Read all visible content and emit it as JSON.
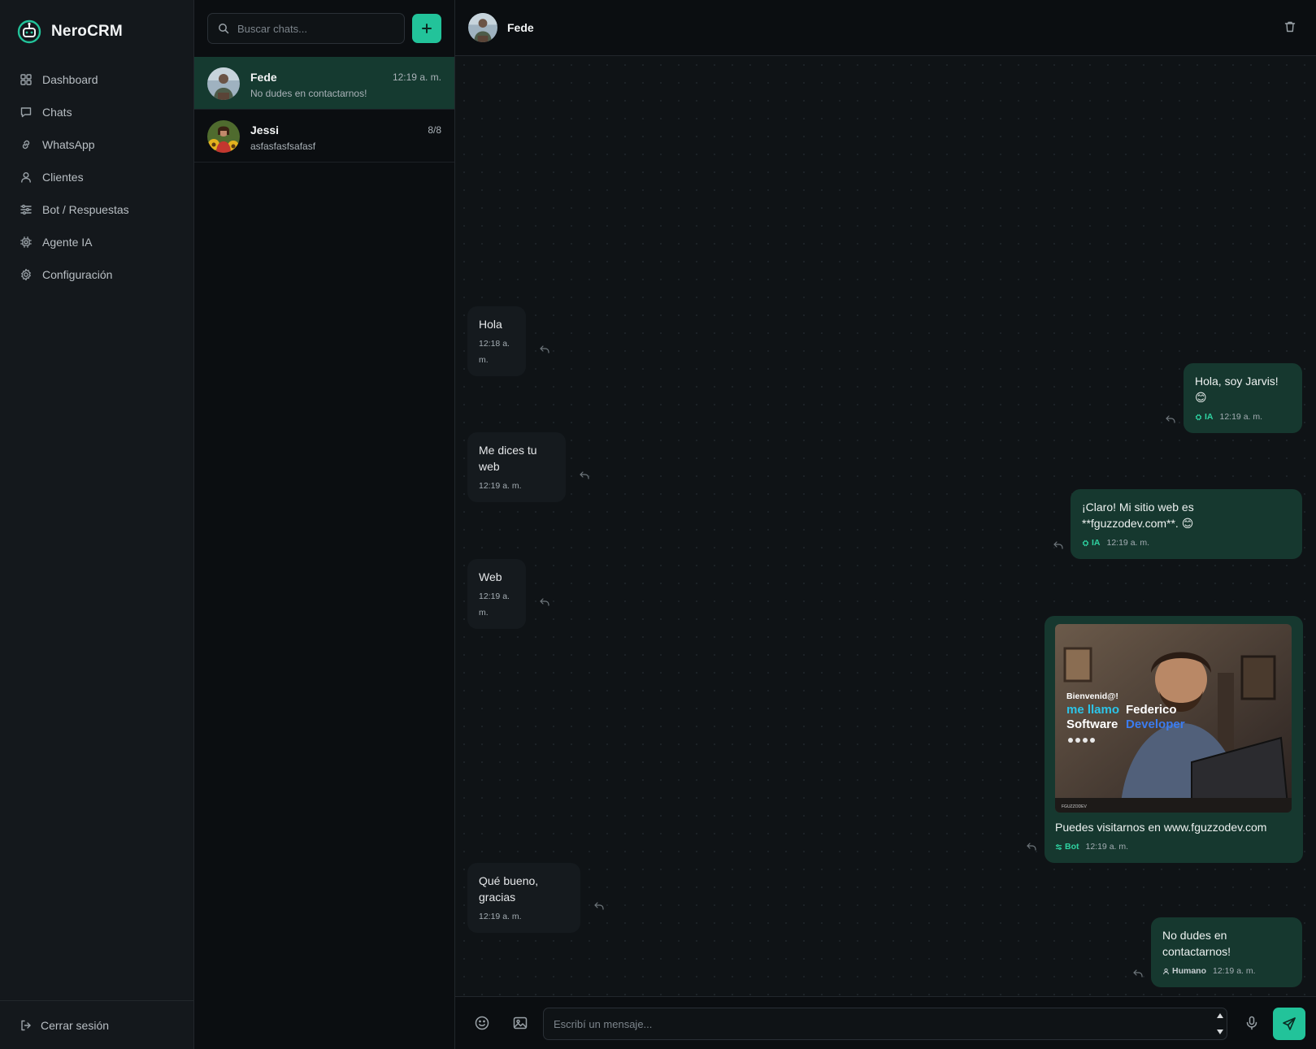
{
  "app": {
    "name": "NeroCRM"
  },
  "sidebar": {
    "items": [
      {
        "label": "Dashboard",
        "icon": "dashboard-grid-icon"
      },
      {
        "label": "Chats",
        "icon": "chat-bubble-icon"
      },
      {
        "label": "WhatsApp",
        "icon": "link-icon"
      },
      {
        "label": "Clientes",
        "icon": "user-icon"
      },
      {
        "label": "Bot / Respuestas",
        "icon": "sliders-icon"
      },
      {
        "label": "Agente IA",
        "icon": "cpu-icon"
      },
      {
        "label": "Configuración",
        "icon": "gear-icon"
      }
    ],
    "logout_label": "Cerrar sesión"
  },
  "chatlist": {
    "search_placeholder": "Buscar chats...",
    "chats": [
      {
        "name": "Fede",
        "preview": "No dudes en contactarnos!",
        "time": "12:19 a. m.",
        "active": true
      },
      {
        "name": "Jessi",
        "preview": "asfasfasfsafasf",
        "time": "8/8",
        "active": false
      }
    ]
  },
  "conversation": {
    "contact_name": "Fede",
    "messages": [
      {
        "direction": "in",
        "text": "Hola",
        "time": "12:18 a. m."
      },
      {
        "direction": "out",
        "text": "Hola, soy Jarvis! 😊",
        "source": "IA",
        "time": "12:19 a. m."
      },
      {
        "direction": "in",
        "text": "Me dices tu web",
        "time": "12:19 a. m."
      },
      {
        "direction": "out",
        "text": "¡Claro! Mi sitio web es **fguzzodev.com**. 😊",
        "source": "IA",
        "time": "12:19 a. m."
      },
      {
        "direction": "in",
        "text": "Web",
        "time": "12:19 a. m."
      },
      {
        "direction": "out",
        "text": "Puedes visitarnos en www.fguzzodev.com",
        "source": "Bot",
        "time": "12:19 a. m.",
        "image": {
          "line1": "Bienvenid@!",
          "line2a": "me llamo",
          "line2b": "Federico",
          "line3a": "Software",
          "line3b": "Developer",
          "brand": "FGUZZODEV"
        }
      },
      {
        "direction": "in",
        "text": "Qué bueno, gracias",
        "time": "12:19 a. m."
      },
      {
        "direction": "out",
        "text": "No dudes en contactarnos!",
        "source": "Humano",
        "time": "12:19 a. m."
      }
    ],
    "composer_placeholder": "Escribí un mensaje..."
  },
  "colors": {
    "accent": "#22c39a",
    "active_chat": "#153a30",
    "outgoing_bubble": "#16382f",
    "incoming_bubble": "#151a1e"
  }
}
